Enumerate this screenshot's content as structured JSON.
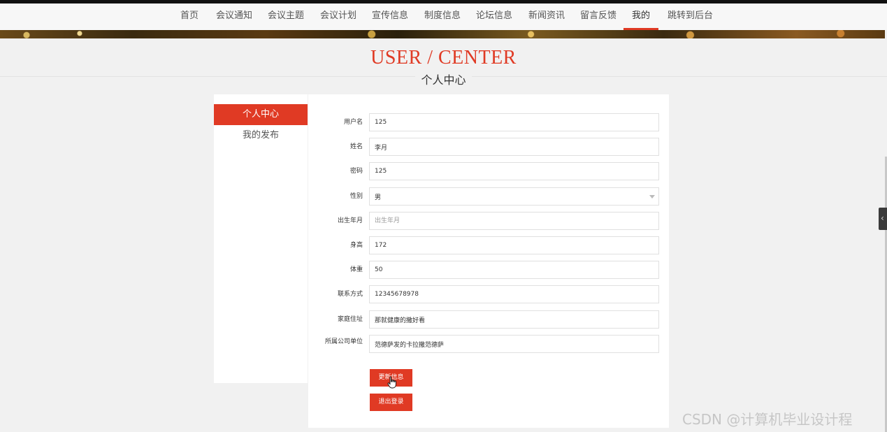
{
  "nav": {
    "items": [
      {
        "label": "首页",
        "active": false
      },
      {
        "label": "会议通知",
        "active": false
      },
      {
        "label": "会议主题",
        "active": false
      },
      {
        "label": "会议计划",
        "active": false
      },
      {
        "label": "宣传信息",
        "active": false
      },
      {
        "label": "制度信息",
        "active": false
      },
      {
        "label": "论坛信息",
        "active": false
      },
      {
        "label": "新闻资讯",
        "active": false
      },
      {
        "label": "留言反馈",
        "active": false
      },
      {
        "label": "我的",
        "active": true
      },
      {
        "label": "跳转到后台",
        "active": false
      }
    ]
  },
  "header": {
    "title_en": "USER / CENTER",
    "title_cn": "个人中心"
  },
  "sidebar": {
    "items": [
      {
        "label": "个人中心",
        "active": true
      },
      {
        "label": "我的发布",
        "active": false
      }
    ]
  },
  "form": {
    "fields": [
      {
        "label": "用户名",
        "value": "125",
        "placeholder": ""
      },
      {
        "label": "姓名",
        "value": "李月",
        "placeholder": ""
      },
      {
        "label": "密码",
        "value": "125",
        "placeholder": ""
      },
      {
        "label": "性别",
        "value": "男",
        "placeholder": ""
      },
      {
        "label": "出生年月",
        "value": "",
        "placeholder": "出生年月"
      },
      {
        "label": "身高",
        "value": "172",
        "placeholder": ""
      },
      {
        "label": "体重",
        "value": "50",
        "placeholder": ""
      },
      {
        "label": "联系方式",
        "value": "12345678978",
        "placeholder": ""
      },
      {
        "label": "家庭住址",
        "value": "那就健康的撒好看",
        "placeholder": ""
      },
      {
        "label": "所属公司单位",
        "value": "范德萨发的卡拉撒范德萨",
        "placeholder": ""
      }
    ],
    "update_label": "更新信息",
    "logout_label": "退出登录"
  },
  "side_toggle_icon": "chevron-left-icon",
  "watermark": "CSDN @计算机毕业设计程",
  "colors": {
    "accent": "#e03a24",
    "background": "#f1f1f1",
    "panel": "#ffffff"
  }
}
